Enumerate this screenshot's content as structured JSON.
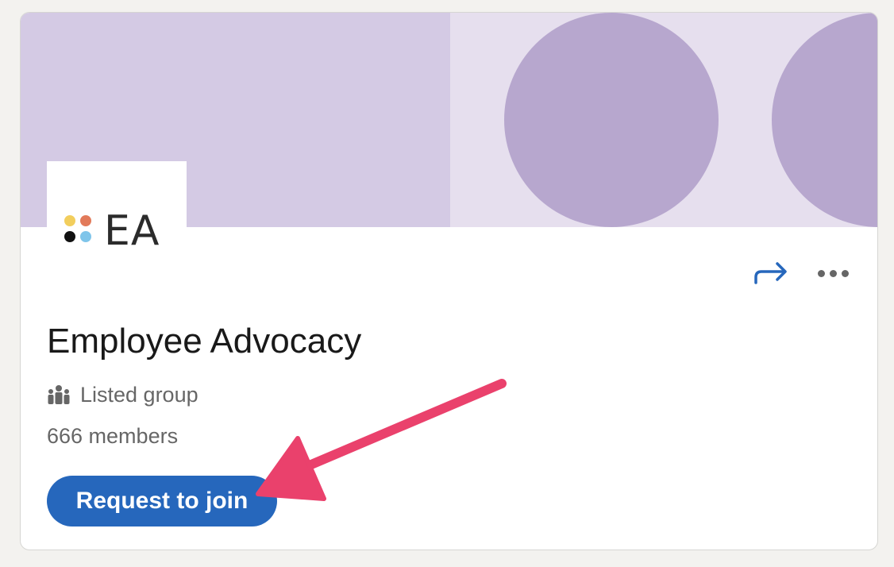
{
  "group": {
    "logo_text": "EA",
    "title": "Employee Advocacy",
    "visibility_label": "Listed group",
    "members_text": "666 members",
    "join_button_label": "Request to join"
  },
  "icons": {
    "share": "share-arrow-icon",
    "more": "more-horizontal-icon",
    "group_type": "people-icon"
  },
  "colors": {
    "cover_light": "#d4cae4",
    "cover_lighter": "#e6dfee",
    "cover_circle": "#b7a7ce",
    "primary_button": "#2667bc",
    "annotation_arrow": "#ea416c"
  }
}
